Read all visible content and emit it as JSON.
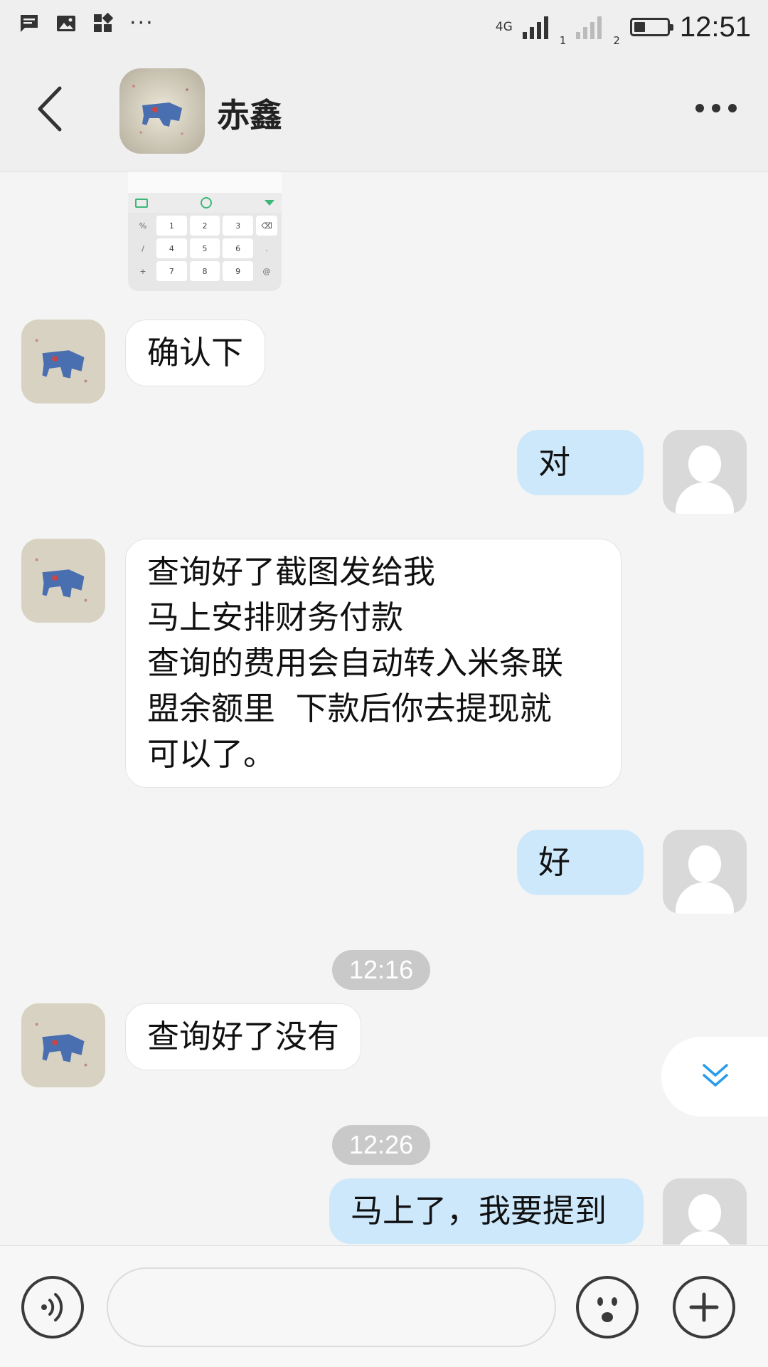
{
  "status_bar": {
    "time": "12:51",
    "network_type": "4G",
    "sim1_label": "1",
    "sim2_label": "2",
    "more_indicator": "···",
    "battery_level_percent": 35
  },
  "header": {
    "contact_name": "赤鑫"
  },
  "thumbnail": {
    "keys": [
      "%",
      "1",
      "2",
      "3",
      "⌫",
      "/",
      "4",
      "5",
      "6",
      ".",
      "+",
      "7",
      "8",
      "9",
      "@"
    ]
  },
  "messages": {
    "m1": "确认下",
    "m2": "对",
    "m3": [
      "查询好了截图发给我",
      "马上安排财务付款",
      "查询的费用会自动转入米条联",
      "盟余额里  下款后你去提现就",
      "可以了。"
    ],
    "time1": "12:16",
    "m4": "好",
    "m5": "查询好了没有",
    "time2": "12:26",
    "m6": "马上了，我要提到"
  },
  "input": {
    "value": "",
    "placeholder": ""
  },
  "colors": {
    "outgoing_bubble": "#cde8fb",
    "incoming_bubble": "#ffffff",
    "chat_background": "#f4f4f4",
    "scroll_arrow": "#2a9ce8"
  }
}
